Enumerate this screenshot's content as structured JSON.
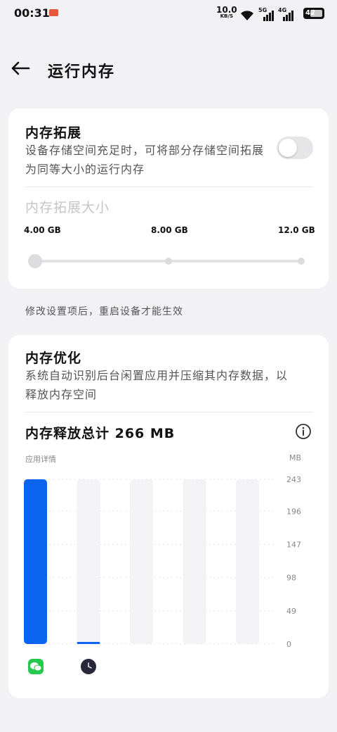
{
  "status_bar": {
    "time": "00:31",
    "net_speed": "10.0",
    "net_speed_unit": "KB/S",
    "sim1": "5G",
    "sim2": "4G",
    "battery": "42"
  },
  "header": {
    "title": "运行内存",
    "back_icon": "back-arrow-icon"
  },
  "expansion": {
    "title": "内存拓展",
    "description": "设备存储空间充足时，可将部分存储空间拓展为同等大小的运行内存",
    "toggle_on": false,
    "size_label": "内存拓展大小",
    "options": [
      "4.00 GB",
      "8.00 GB",
      "12.0 GB"
    ],
    "selected": "4.00 GB"
  },
  "hint": "修改设置项后，重启设备才能生效",
  "optimization": {
    "title": "内存优化",
    "description": "系统自动识别后台闲置应用并压缩其内存数据，以释放内存空间",
    "release_total": "内存释放总计 266 MB",
    "info_icon": "info-icon"
  },
  "chart_data": {
    "type": "bar",
    "title": "",
    "xlabel": "应用详情",
    "ylabel": "MB",
    "y_ticks": [
      "243",
      "196",
      "147",
      "98",
      "49",
      "0"
    ],
    "ylim": [
      0,
      243
    ],
    "categories": [
      "wechat-icon",
      "clock-icon",
      "",
      "",
      ""
    ],
    "values": [
      243,
      3,
      0,
      0,
      0
    ],
    "bar_color": "#0a64f0",
    "track_color": "#f3f3f5",
    "grid": true
  }
}
